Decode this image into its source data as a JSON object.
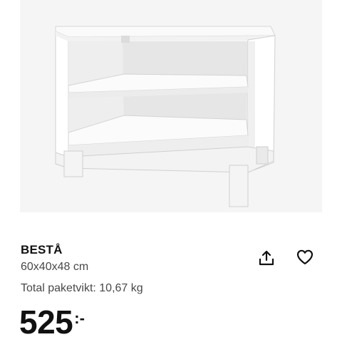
{
  "product": {
    "image_alt": "BESTÅ shelf unit",
    "name": "BESTÅ",
    "description": "60x40x48 cm",
    "weight": "Total paketvikt: 10,67 kg",
    "price": {
      "amount": "525",
      "suffix": ":-"
    }
  },
  "actions": {
    "share_icon": "share-icon",
    "favorite_icon": "heart-icon"
  },
  "colors": {
    "image_background": "#f5f5f5",
    "text_primary": "#111111",
    "text_secondary": "#484848"
  }
}
